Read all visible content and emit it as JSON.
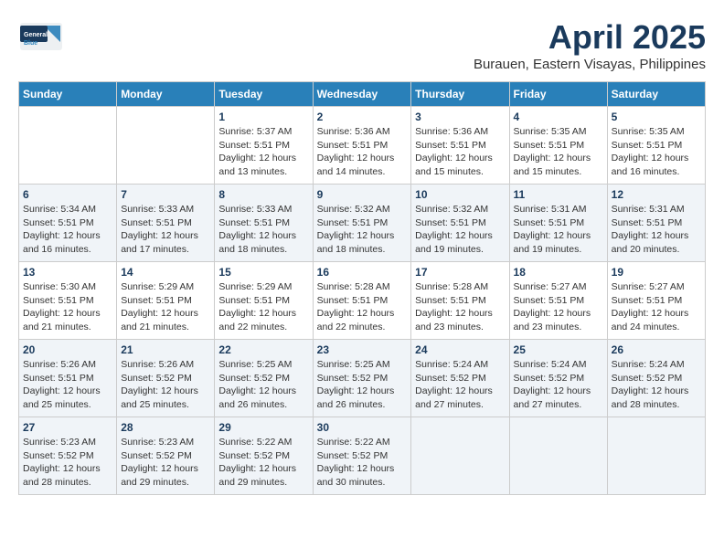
{
  "header": {
    "logo_general": "General",
    "logo_blue": "Blue",
    "month": "April 2025",
    "location": "Burauen, Eastern Visayas, Philippines"
  },
  "weekdays": [
    "Sunday",
    "Monday",
    "Tuesday",
    "Wednesday",
    "Thursday",
    "Friday",
    "Saturday"
  ],
  "rows": [
    {
      "cells": [
        {
          "day": "",
          "info": ""
        },
        {
          "day": "",
          "info": ""
        },
        {
          "day": "1",
          "info": "Sunrise: 5:37 AM\nSunset: 5:51 PM\nDaylight: 12 hours and 13 minutes."
        },
        {
          "day": "2",
          "info": "Sunrise: 5:36 AM\nSunset: 5:51 PM\nDaylight: 12 hours and 14 minutes."
        },
        {
          "day": "3",
          "info": "Sunrise: 5:36 AM\nSunset: 5:51 PM\nDaylight: 12 hours and 15 minutes."
        },
        {
          "day": "4",
          "info": "Sunrise: 5:35 AM\nSunset: 5:51 PM\nDaylight: 12 hours and 15 minutes."
        },
        {
          "day": "5",
          "info": "Sunrise: 5:35 AM\nSunset: 5:51 PM\nDaylight: 12 hours and 16 minutes."
        }
      ]
    },
    {
      "cells": [
        {
          "day": "6",
          "info": "Sunrise: 5:34 AM\nSunset: 5:51 PM\nDaylight: 12 hours and 16 minutes."
        },
        {
          "day": "7",
          "info": "Sunrise: 5:33 AM\nSunset: 5:51 PM\nDaylight: 12 hours and 17 minutes."
        },
        {
          "day": "8",
          "info": "Sunrise: 5:33 AM\nSunset: 5:51 PM\nDaylight: 12 hours and 18 minutes."
        },
        {
          "day": "9",
          "info": "Sunrise: 5:32 AM\nSunset: 5:51 PM\nDaylight: 12 hours and 18 minutes."
        },
        {
          "day": "10",
          "info": "Sunrise: 5:32 AM\nSunset: 5:51 PM\nDaylight: 12 hours and 19 minutes."
        },
        {
          "day": "11",
          "info": "Sunrise: 5:31 AM\nSunset: 5:51 PM\nDaylight: 12 hours and 19 minutes."
        },
        {
          "day": "12",
          "info": "Sunrise: 5:31 AM\nSunset: 5:51 PM\nDaylight: 12 hours and 20 minutes."
        }
      ]
    },
    {
      "cells": [
        {
          "day": "13",
          "info": "Sunrise: 5:30 AM\nSunset: 5:51 PM\nDaylight: 12 hours and 21 minutes."
        },
        {
          "day": "14",
          "info": "Sunrise: 5:29 AM\nSunset: 5:51 PM\nDaylight: 12 hours and 21 minutes."
        },
        {
          "day": "15",
          "info": "Sunrise: 5:29 AM\nSunset: 5:51 PM\nDaylight: 12 hours and 22 minutes."
        },
        {
          "day": "16",
          "info": "Sunrise: 5:28 AM\nSunset: 5:51 PM\nDaylight: 12 hours and 22 minutes."
        },
        {
          "day": "17",
          "info": "Sunrise: 5:28 AM\nSunset: 5:51 PM\nDaylight: 12 hours and 23 minutes."
        },
        {
          "day": "18",
          "info": "Sunrise: 5:27 AM\nSunset: 5:51 PM\nDaylight: 12 hours and 23 minutes."
        },
        {
          "day": "19",
          "info": "Sunrise: 5:27 AM\nSunset: 5:51 PM\nDaylight: 12 hours and 24 minutes."
        }
      ]
    },
    {
      "cells": [
        {
          "day": "20",
          "info": "Sunrise: 5:26 AM\nSunset: 5:51 PM\nDaylight: 12 hours and 25 minutes."
        },
        {
          "day": "21",
          "info": "Sunrise: 5:26 AM\nSunset: 5:52 PM\nDaylight: 12 hours and 25 minutes."
        },
        {
          "day": "22",
          "info": "Sunrise: 5:25 AM\nSunset: 5:52 PM\nDaylight: 12 hours and 26 minutes."
        },
        {
          "day": "23",
          "info": "Sunrise: 5:25 AM\nSunset: 5:52 PM\nDaylight: 12 hours and 26 minutes."
        },
        {
          "day": "24",
          "info": "Sunrise: 5:24 AM\nSunset: 5:52 PM\nDaylight: 12 hours and 27 minutes."
        },
        {
          "day": "25",
          "info": "Sunrise: 5:24 AM\nSunset: 5:52 PM\nDaylight: 12 hours and 27 minutes."
        },
        {
          "day": "26",
          "info": "Sunrise: 5:24 AM\nSunset: 5:52 PM\nDaylight: 12 hours and 28 minutes."
        }
      ]
    },
    {
      "cells": [
        {
          "day": "27",
          "info": "Sunrise: 5:23 AM\nSunset: 5:52 PM\nDaylight: 12 hours and 28 minutes."
        },
        {
          "day": "28",
          "info": "Sunrise: 5:23 AM\nSunset: 5:52 PM\nDaylight: 12 hours and 29 minutes."
        },
        {
          "day": "29",
          "info": "Sunrise: 5:22 AM\nSunset: 5:52 PM\nDaylight: 12 hours and 29 minutes."
        },
        {
          "day": "30",
          "info": "Sunrise: 5:22 AM\nSunset: 5:52 PM\nDaylight: 12 hours and 30 minutes."
        },
        {
          "day": "",
          "info": ""
        },
        {
          "day": "",
          "info": ""
        },
        {
          "day": "",
          "info": ""
        }
      ]
    }
  ]
}
